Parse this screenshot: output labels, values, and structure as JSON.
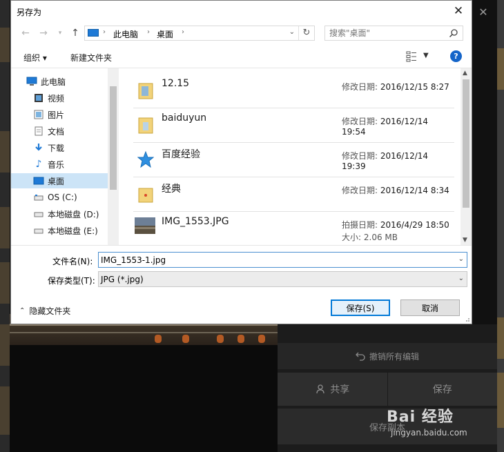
{
  "dialog": {
    "title": "另存为",
    "close_glyph": "✕"
  },
  "address": {
    "crumbs": [
      "此电脑",
      "桌面"
    ],
    "refresh_glyph": "↻"
  },
  "search": {
    "placeholder": "搜索\"桌面\""
  },
  "toolbar": {
    "organize_label": "组织 ▾",
    "new_folder_label": "新建文件夹",
    "help_label": "?"
  },
  "sidebar": {
    "items": [
      {
        "label": "此电脑",
        "icon": "computer-icon"
      },
      {
        "label": "视频",
        "icon": "video-icon"
      },
      {
        "label": "图片",
        "icon": "image-icon"
      },
      {
        "label": "文档",
        "icon": "document-icon"
      },
      {
        "label": "下载",
        "icon": "download-icon"
      },
      {
        "label": "音乐",
        "icon": "music-icon"
      },
      {
        "label": "桌面",
        "icon": "desktop-icon",
        "selected": true
      },
      {
        "label": "OS (C:)",
        "icon": "drive-icon"
      },
      {
        "label": "本地磁盘 (D:)",
        "icon": "drive-icon"
      },
      {
        "label": "本地磁盘 (E:)",
        "icon": "drive-icon"
      }
    ]
  },
  "files": [
    {
      "name": "12.15",
      "icon": "folder-icon",
      "meta_label": "修改日期:",
      "meta_value": "2016/12/15 8:27"
    },
    {
      "name": "baiduyun",
      "icon": "folder-icon",
      "meta_label": "修改日期:",
      "meta_value": "2016/12/14 19:54"
    },
    {
      "name": "百度经验",
      "icon": "star-icon",
      "meta_label": "修改日期:",
      "meta_value": "2016/12/14 19:39"
    },
    {
      "name": "经典",
      "icon": "folder-icon",
      "meta_label": "修改日期:",
      "meta_value": "2016/12/14 8:34"
    },
    {
      "name": "IMG_1553.JPG",
      "icon": "image-thumbnail-icon",
      "meta_label": "拍摄日期:",
      "meta_value": "2016/4/29 18:50",
      "size_label": "大小:",
      "size_value": "2.06 MB"
    }
  ],
  "filename": {
    "label": "文件名(N):",
    "value": "IMG_1553-1.jpg"
  },
  "filetype": {
    "label": "保存类型(T):",
    "value": "JPG (*.jpg)"
  },
  "footer": {
    "hide_folders_label": "隐藏文件夹",
    "save_label": "保存(S)",
    "cancel_label": "取消"
  },
  "background_app": {
    "undo_all_label": "撤销所有编辑",
    "share_label": "共享",
    "save_label": "保存",
    "save_copy_label": "保存副本",
    "close_glyph": "✕"
  },
  "watermark": {
    "main": "Bai 经验",
    "sub": "jingyan.baidu.com"
  },
  "colors": {
    "accent": "#0078d7",
    "selection": "#cce4f7",
    "help_blue": "#1565c9"
  }
}
